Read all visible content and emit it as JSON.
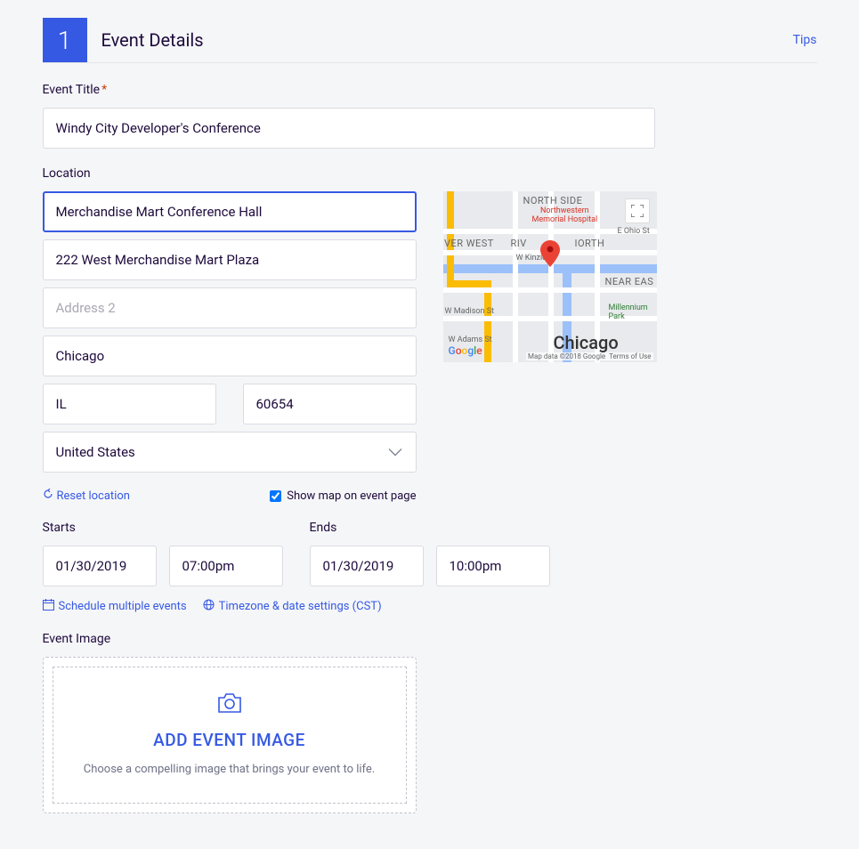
{
  "section": {
    "step_number": "1",
    "title": "Event Details",
    "tips_label": "Tips"
  },
  "event_title": {
    "label": "Event Title",
    "required_marker": "*",
    "value": "Windy City Developer's Conference"
  },
  "location": {
    "label": "Location",
    "venue": "Merchandise Mart Conference Hall",
    "address1": "222 West Merchandise Mart Plaza",
    "address2_placeholder": "Address 2",
    "city": "Chicago",
    "state": "IL",
    "postal": "60654",
    "country": "United States",
    "reset_label": "Reset location",
    "show_map_label": "Show map on event page",
    "show_map_checked": true,
    "map": {
      "labels": {
        "north_side": "NORTH SIDE",
        "river_west": "IVER WEST",
        "river_north": "RIV",
        "river_north2": "IORTH",
        "near_east": "NEAR EAS",
        "city": "Chicago",
        "hospital": "Northwestern\nMemorial Hospital",
        "kinzie": "W Kinzie St",
        "madison": "W Madison St",
        "adams": "W Adams St",
        "ohio": "E Ohio St",
        "park": "Millennium\nPark"
      },
      "google_logo": "Google",
      "attribution": "Map data ©2018 Google",
      "terms": "Terms of Use"
    }
  },
  "starts": {
    "label": "Starts",
    "date": "01/30/2019",
    "time": "07:00pm"
  },
  "ends": {
    "label": "Ends",
    "date": "01/30/2019",
    "time": "10:00pm"
  },
  "datetime_links": {
    "schedule_multiple": "Schedule multiple events",
    "timezone": "Timezone & date settings (CST)"
  },
  "event_image": {
    "label": "Event Image",
    "upload_title": "ADD EVENT IMAGE",
    "upload_sub": "Choose a compelling image that brings your event to life."
  }
}
